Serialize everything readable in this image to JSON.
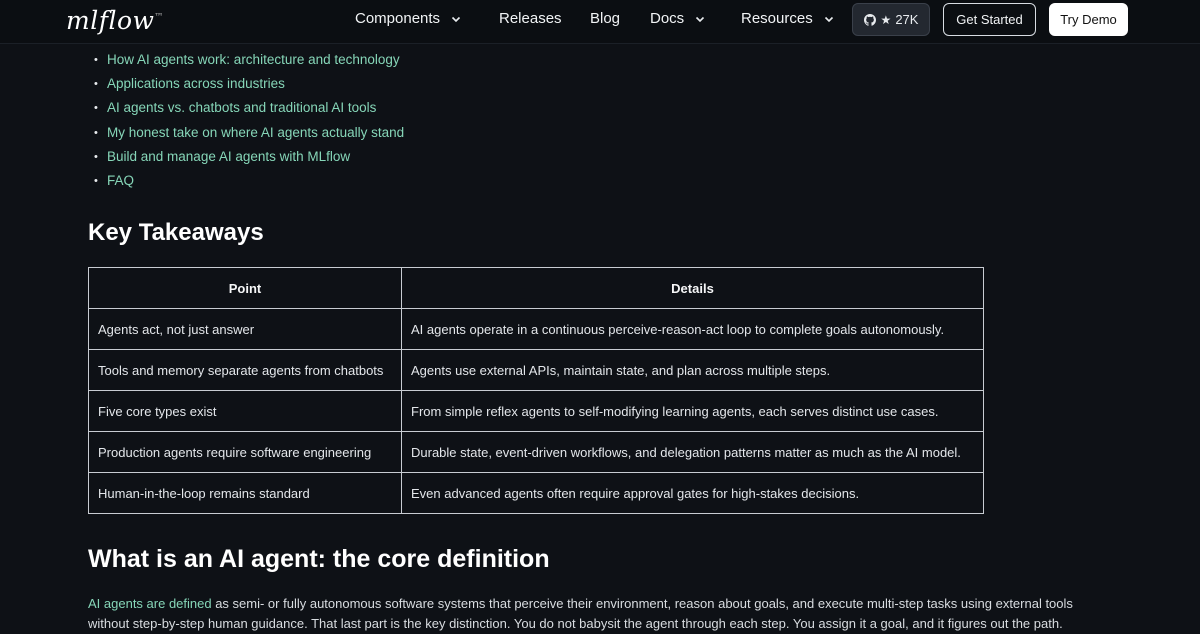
{
  "nav": {
    "logo": "mlflow",
    "logo_mark": "™",
    "items": [
      {
        "label": "Components",
        "dropdown": true
      },
      {
        "label": "Releases",
        "dropdown": false
      },
      {
        "label": "Blog",
        "dropdown": false
      },
      {
        "label": "Docs",
        "dropdown": true
      },
      {
        "label": "Resources",
        "dropdown": true
      }
    ],
    "github_stars": "27K",
    "get_started": "Get Started",
    "try_demo": "Try Demo"
  },
  "toc": [
    "How AI agents work: architecture and technology",
    "Applications across industries",
    "AI agents vs. chatbots and traditional AI tools",
    "My honest take on where AI agents actually stand",
    "Build and manage AI agents with MLflow",
    "FAQ"
  ],
  "key_takeaways": {
    "heading": "Key Takeaways",
    "headers": [
      "Point",
      "Details"
    ],
    "rows": [
      [
        "Agents act, not just answer",
        "AI agents operate in a continuous perceive-reason-act loop to complete goals autonomously."
      ],
      [
        "Tools and memory separate agents from chatbots",
        "Agents use external APIs, maintain state, and plan across multiple steps."
      ],
      [
        "Five core types exist",
        "From simple reflex agents to self-modifying learning agents, each serves distinct use cases."
      ],
      [
        "Production agents require software engineering",
        "Durable state, event-driven workflows, and delegation patterns matter as much as the AI model."
      ],
      [
        "Human-in-the-loop remains standard",
        "Even advanced agents often require approval gates for high-stakes decisions."
      ]
    ]
  },
  "definition": {
    "heading": "What is an AI agent: the core definition",
    "link_text": "AI agents are defined",
    "text_after_link": " as semi- or fully autonomous software systems that perceive their environment, reason about goals, and execute multi-step tasks using external tools without step-by-step human guidance. That last part is the key distinction. You do not babysit the agent through each step. You assign it a goal, and it figures out the path."
  },
  "colors": {
    "background": "#0e1116",
    "link": "#86d6b8",
    "table_border": "#c8ccd2"
  }
}
